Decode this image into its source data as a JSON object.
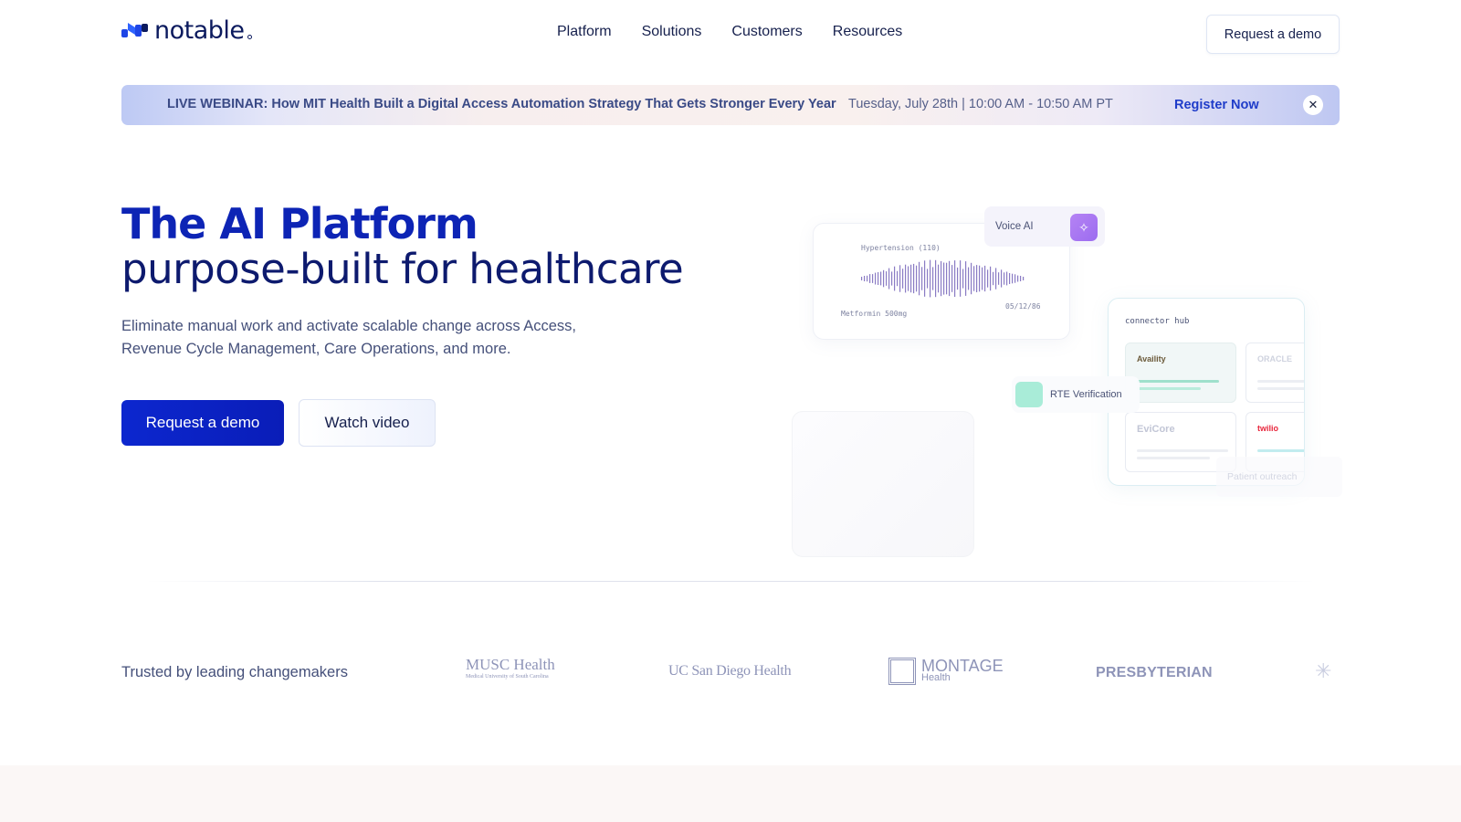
{
  "brand": {
    "name": "notable"
  },
  "nav": {
    "items": [
      "Platform",
      "Solutions",
      "Customers",
      "Resources"
    ],
    "cta": "Request a demo"
  },
  "banner": {
    "title": "LIVE WEBINAR: How MIT Health Built a Digital Access Automation Strategy That Gets Stronger Every Year",
    "date": "Tuesday, July 28th | 10:00 AM - 10:50 AM PT",
    "register": "Register Now",
    "close_icon": "close-icon"
  },
  "hero": {
    "title_line1": "The AI Platform",
    "title_line2": "purpose-built for healthcare",
    "subtitle": "Eliminate manual work and activate scalable change across Access, Revenue Cycle Management, Care Operations, and more.",
    "primary_cta": "Request a demo",
    "secondary_cta": "Watch video"
  },
  "illustration": {
    "voice_card": {
      "top_label": "Hypertension (110)",
      "bottom_label": "Metformin 500mg",
      "date": "05/12/86"
    },
    "voice_chip": {
      "label": "Voice AI",
      "icon": "sparkle-icon"
    },
    "connector_hub": {
      "title": "connector hub",
      "tiles": [
        "Availity",
        "ORACLE",
        "EviCore",
        "twilio"
      ]
    },
    "rte_chip": {
      "label": "RTE Verification"
    },
    "outreach": {
      "label": "Patient outreach"
    }
  },
  "trusted": {
    "label": "Trusted by leading changemakers",
    "logos": {
      "musc": "MUSC Health",
      "musc_sub": "Medical University of South Carolina",
      "ucsd": "UC San Diego Health",
      "montage": "MONTAGE",
      "montage_sub": "Health",
      "presbyterian": "PRESBYTERIAN"
    }
  },
  "colors": {
    "primary": "#0c27cf",
    "heading_dark": "#0d1a6e",
    "body_text": "#45507a"
  }
}
